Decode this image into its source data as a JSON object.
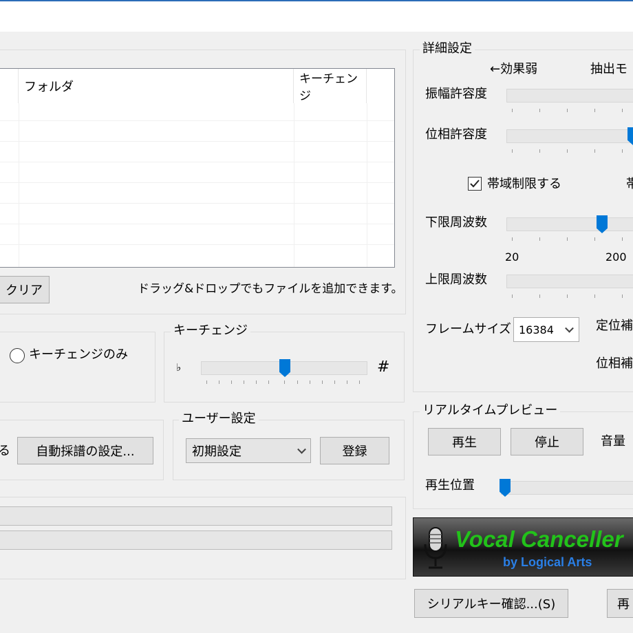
{
  "file_list": {
    "columns": [
      "フォルダ",
      "キーチェンジ"
    ],
    "clear_label": "クリア",
    "hint": "ドラッグ&ドロップでもファイルを追加できます。"
  },
  "mode": {
    "key_change_only_label": "キーチェンジのみ"
  },
  "key_change": {
    "title": "キーチェンジ",
    "flat_symbol": "♭",
    "sharp_symbol": "#",
    "level": 0.5
  },
  "auto_transcribe": {
    "partial_label": "る",
    "settings_button": "自動採譜の設定..."
  },
  "user_settings": {
    "title": "ユーザー設定",
    "preset": "初期設定",
    "register_button": "登録"
  },
  "detail": {
    "title": "詳細設定",
    "effect_weak": "←効果弱",
    "extract_mode_partial": "抽出モ",
    "amplitude_tolerance": "振幅許容度",
    "phase_tolerance": "位相許容度",
    "band_limit_label": "帯域制限する",
    "band_limit_checked": true,
    "band_partial": "帯",
    "lower_freq": "下限周波数",
    "lower_ticks": [
      "20",
      "200"
    ],
    "upper_freq": "上限周波数",
    "frame_size_label": "フレームサイズ",
    "frame_size_value": "16384",
    "fixed_pos_partial": "定位補",
    "phase_partial": "位相補"
  },
  "preview": {
    "title": "リアルタイムプレビュー",
    "play_button": "再生",
    "stop_button": "停止",
    "volume_label": "音量",
    "position_label": "再生位置"
  },
  "logo": {
    "title": "Vocal Canceller",
    "subtitle": "by Logical Arts"
  },
  "footer": {
    "serial_button": "シリアルキー確認...(S)",
    "partial_button": "再"
  },
  "colors": {
    "accent": "#0078d7",
    "logo_green": "#22c21a",
    "logo_blue": "#2a7fe6",
    "titlebar_line": "#2b6cb8"
  }
}
